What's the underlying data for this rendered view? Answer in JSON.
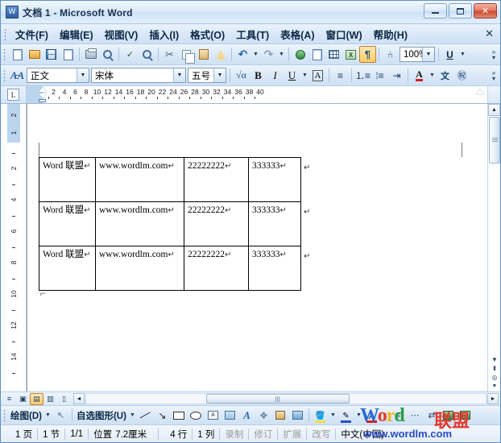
{
  "window": {
    "title": "文档 1 - Microsoft Word",
    "app_icon": "word-icon",
    "minimize_label": "最小化",
    "maximize_label": "最大化",
    "close_label": "关闭"
  },
  "menu": {
    "items": [
      {
        "label": "文件(F)",
        "name": "menu-file"
      },
      {
        "label": "编辑(E)",
        "name": "menu-edit"
      },
      {
        "label": "视图(V)",
        "name": "menu-view"
      },
      {
        "label": "插入(I)",
        "name": "menu-insert"
      },
      {
        "label": "格式(O)",
        "name": "menu-format"
      },
      {
        "label": "工具(T)",
        "name": "menu-tools"
      },
      {
        "label": "表格(A)",
        "name": "menu-table"
      },
      {
        "label": "窗口(W)",
        "name": "menu-window"
      },
      {
        "label": "帮助(H)",
        "name": "menu-help"
      }
    ],
    "close_document_label": "✕"
  },
  "standard_toolbar": {
    "zoom_value": "100%",
    "buttons": [
      {
        "name": "new-document-icon",
        "title": "新建"
      },
      {
        "name": "open-folder-icon",
        "title": "打开"
      },
      {
        "name": "save-icon",
        "title": "保存"
      },
      {
        "name": "permission-icon",
        "title": "权限"
      },
      {
        "name": "print-icon",
        "title": "打印"
      },
      {
        "name": "print-preview-icon",
        "title": "打印预览"
      },
      {
        "name": "spelling-check-icon",
        "title": "拼写和语法"
      },
      {
        "name": "research-icon",
        "title": "信息检索"
      },
      {
        "name": "cut-icon",
        "title": "剪切"
      },
      {
        "name": "copy-icon",
        "title": "复制"
      },
      {
        "name": "paste-icon",
        "title": "粘贴"
      },
      {
        "name": "format-painter-icon",
        "title": "格式刷"
      },
      {
        "name": "undo-icon",
        "title": "撤消"
      },
      {
        "name": "redo-icon",
        "title": "恢复"
      },
      {
        "name": "insert-hyperlink-icon",
        "title": "插入超链接"
      },
      {
        "name": "tables-and-borders-icon",
        "title": "表格和边框"
      },
      {
        "name": "insert-table-icon",
        "title": "插入表格"
      },
      {
        "name": "insert-excel-sheet-icon",
        "title": "插入Excel表格"
      },
      {
        "name": "show-formatting-marks-icon",
        "title": "显示/隐藏编辑标记"
      },
      {
        "name": "document-map-icon",
        "title": "文档结构图"
      },
      {
        "name": "underline-style-icon",
        "title": "下划线"
      }
    ]
  },
  "formatting_toolbar": {
    "style_value": "正文",
    "font_value": "宋体",
    "size_value": "五号",
    "buttons": [
      {
        "name": "styles-and-formatting-icon",
        "title": "样式和格式"
      },
      {
        "name": "formula-icon",
        "title": "公式"
      },
      {
        "name": "bold-icon",
        "title": "加粗"
      },
      {
        "name": "italic-icon",
        "title": "倾斜"
      },
      {
        "name": "underline-icon",
        "title": "下划线"
      },
      {
        "name": "character-border-icon",
        "title": "字符边框"
      },
      {
        "name": "align-center-icon",
        "title": "居中"
      },
      {
        "name": "numbered-list-icon",
        "title": "编号"
      },
      {
        "name": "bulleted-list-icon",
        "title": "项目符号"
      },
      {
        "name": "increase-indent-icon",
        "title": "增加缩进量"
      },
      {
        "name": "font-color-icon",
        "title": "字体颜色"
      },
      {
        "name": "phonetic-guide-icon",
        "title": "拼音指南"
      },
      {
        "name": "enclose-character-icon",
        "title": "带圈字符"
      }
    ]
  },
  "ruler": {
    "tab_stop_label": "L",
    "horizontal_ticks": [
      2,
      4,
      6,
      8,
      10,
      12,
      14,
      16,
      18,
      20,
      22,
      24,
      26,
      28,
      30,
      32,
      34,
      36,
      38,
      40
    ],
    "vertical_header_ticks": [
      2,
      1
    ],
    "vertical_ticks": [
      2,
      4,
      6,
      8,
      10,
      12,
      14
    ]
  },
  "document": {
    "table": {
      "columns": 4,
      "rows": [
        [
          "Word 联盟",
          "www.wordlm.com",
          "22222222",
          "333333"
        ],
        [
          "Word 联盟",
          "www.wordlm.com",
          "22222222",
          "333333"
        ],
        [
          "Word 联盟",
          "www.wordlm.com",
          "22222222",
          "333333"
        ]
      ],
      "cell_mark": "↵",
      "row_end_mark": "↵"
    },
    "after_table_paragraph_mark": "⌐"
  },
  "view_buttons": [
    {
      "name": "normal-view-icon",
      "label": "≡",
      "selected": false
    },
    {
      "name": "web-layout-view-icon",
      "label": "▣",
      "selected": false
    },
    {
      "name": "print-layout-view-icon",
      "label": "▤",
      "selected": true
    },
    {
      "name": "outline-view-icon",
      "label": "▥",
      "selected": false
    },
    {
      "name": "reading-layout-view-icon",
      "label": "▯",
      "selected": false
    }
  ],
  "drawing_toolbar": {
    "draw_menu_label": "绘图(D)",
    "autoshapes_label": "自选图形(U)",
    "buttons": [
      {
        "name": "select-objects-icon",
        "title": "选择对象"
      },
      {
        "name": "line-icon",
        "title": "直线"
      },
      {
        "name": "arrow-icon",
        "title": "箭头"
      },
      {
        "name": "rectangle-icon",
        "title": "矩形"
      },
      {
        "name": "oval-icon",
        "title": "椭圆"
      },
      {
        "name": "text-box-icon",
        "title": "文本框"
      },
      {
        "name": "vertical-text-box-icon",
        "title": "竖排文本框"
      },
      {
        "name": "wordart-icon",
        "title": "插入艺术字"
      },
      {
        "name": "diagram-icon",
        "title": "插入组织结构图"
      },
      {
        "name": "clip-art-icon",
        "title": "插入剪贴画"
      },
      {
        "name": "picture-icon",
        "title": "插入图片"
      },
      {
        "name": "fill-color-icon",
        "title": "填充颜色"
      },
      {
        "name": "line-color-icon",
        "title": "线条颜色"
      },
      {
        "name": "font-color-icon",
        "title": "字体颜色"
      },
      {
        "name": "line-style-icon",
        "title": "线型"
      },
      {
        "name": "dash-style-icon",
        "title": "虚线线型"
      },
      {
        "name": "arrow-style-icon",
        "title": "箭头样式"
      },
      {
        "name": "shadow-style-icon",
        "title": "阴影样式"
      },
      {
        "name": "3d-style-icon",
        "title": "三维效果样式"
      }
    ]
  },
  "status_bar": {
    "page": "1 页",
    "section": "1 节",
    "page_of": "1/1",
    "position_label": "位置",
    "position_value": "7.2厘米",
    "line": "4 行",
    "column": "1 列",
    "rec": "录制",
    "trk": "修订",
    "ext": "扩展",
    "ovr": "改写",
    "language": "中文(中国)"
  },
  "watermark": {
    "word": "Word",
    "chinese": "联盟",
    "url": "www.wordlm.com",
    "colors": {
      "w": "#2a6ad4",
      "o": "#e23a2e",
      "r": "#f0b41a",
      "d": "#2a9e44",
      "cn": "#e23a2e",
      "url": "#2a4bc8"
    }
  }
}
